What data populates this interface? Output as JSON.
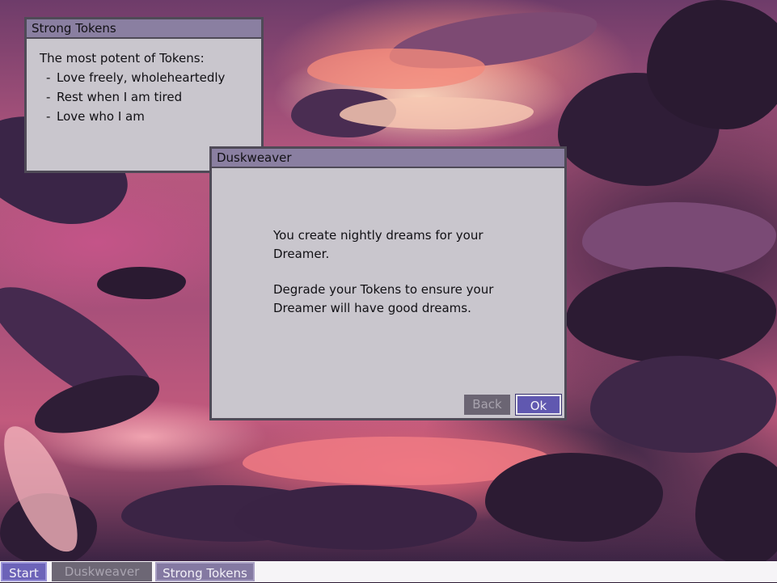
{
  "windows": {
    "strong_tokens": {
      "title": "Strong Tokens",
      "heading": "The most potent of Tokens:",
      "items": [
        "Love freely, wholeheartedly",
        "Rest when I am tired",
        "Love who I am"
      ]
    },
    "duskweaver": {
      "title": "Duskweaver",
      "paragraphs": [
        "You create nightly dreams for your Dreamer.",
        "Degrade your Tokens to ensure your Dreamer will have good dreams."
      ],
      "back_label": "Back",
      "ok_label": "Ok"
    }
  },
  "taskbar": {
    "start_label": "Start",
    "tasks": [
      {
        "label": "Duskweaver",
        "state": "active"
      },
      {
        "label": "Strong Tokens",
        "state": "open"
      }
    ]
  },
  "colors": {
    "titlebar": "#8a7fa1",
    "window_bg": "#c9c6cd",
    "ok_button": "#6058b0",
    "back_button_disabled": "#6b6573",
    "start_button": "#6c63b8"
  }
}
